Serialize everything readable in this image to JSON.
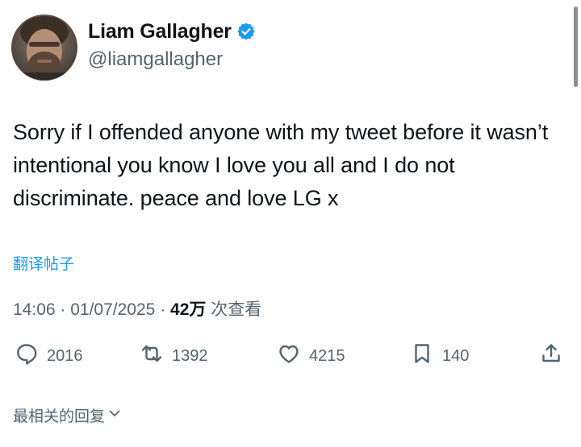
{
  "author": {
    "display_name": "Liam Gallagher",
    "handle": "@liamgallagher",
    "verified": true
  },
  "tweet": {
    "text": "Sorry if I offended anyone with my tweet before it wasn’t intentional you know I love you all and I do not discriminate. peace and love LG x",
    "translate_label": "翻译帖子",
    "time": "14:06",
    "date": "01/07/2025",
    "views_count": "42万",
    "views_label": "次查看"
  },
  "actions": {
    "replies": "2016",
    "retweets": "1392",
    "likes": "4215",
    "bookmarks": "140"
  },
  "replies_sort_label": "最相关的回复",
  "icons": {
    "reply": "reply-icon",
    "retweet": "retweet-icon",
    "like": "heart-icon",
    "bookmark": "bookmark-icon",
    "share": "share-icon",
    "verified": "verified-badge-icon",
    "sort": "chevron-down-icon"
  },
  "colors": {
    "text": "#0f1419",
    "muted": "#536471",
    "link": "#1d9bf0",
    "verified": "#1d9bf0"
  }
}
